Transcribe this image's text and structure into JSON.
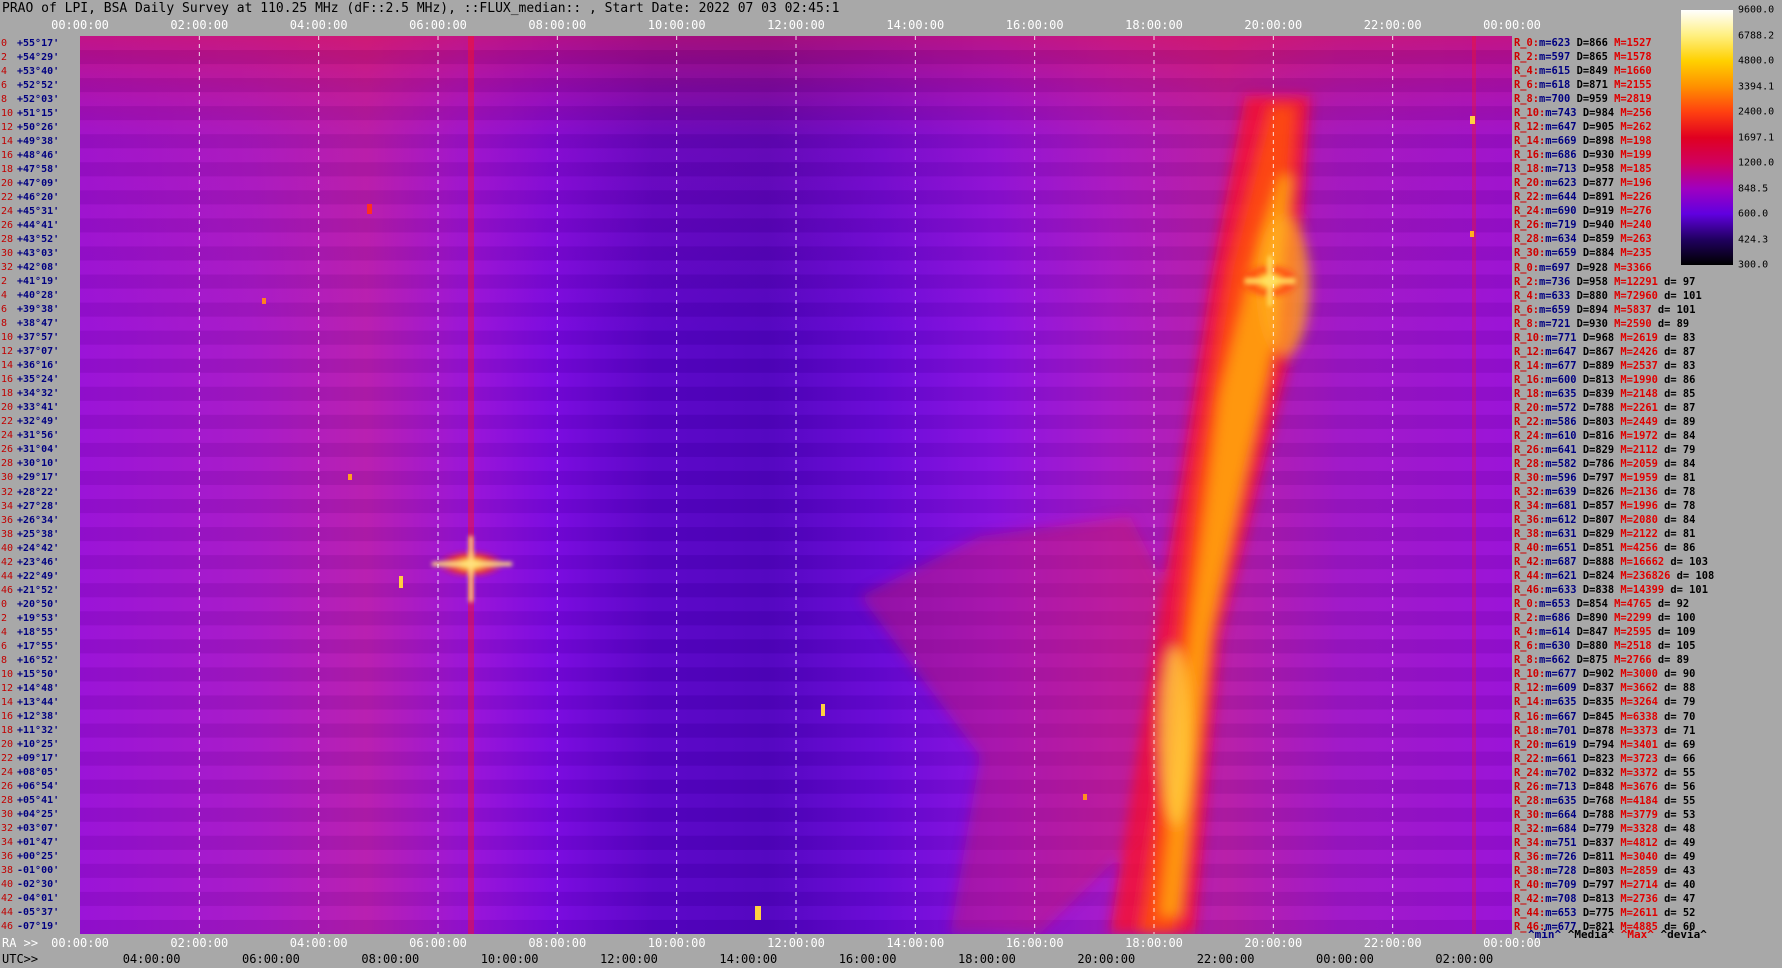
{
  "title": "PRAO of LPI, BSA Daily Survey at 110.25 MHz (dF::2.5 MHz), ::FLUX_median:: , Start Date: 2022 07 03 02:45:1",
  "time_axis": {
    "top_labels": [
      "00:00:00",
      "02:00:00",
      "04:00:00",
      "06:00:00",
      "08:00:00",
      "10:00:00",
      "12:00:00",
      "14:00:00",
      "16:00:00",
      "18:00:00",
      "20:00:00",
      "22:00:00",
      "00:00:00"
    ],
    "ra_prefix": "RA >>",
    "ra_labels": [
      "00:00:00",
      "02:00:00",
      "04:00:00",
      "06:00:00",
      "08:00:00",
      "10:00:00",
      "12:00:00",
      "14:00:00",
      "16:00:00",
      "18:00:00",
      "20:00:00",
      "22:00:00",
      "00:00:00"
    ],
    "utc_prefix": "UTC>>",
    "utc_labels": [
      "04:00:00",
      "06:00:00",
      "08:00:00",
      "10:00:00",
      "12:00:00",
      "14:00:00",
      "16:00:00",
      "18:00:00",
      "20:00:00",
      "22:00:00",
      "00:00:00",
      "02:00:00"
    ]
  },
  "declinations": [
    {
      "i": "0",
      "d": "+55°17'"
    },
    {
      "i": "2",
      "d": "+54°29'"
    },
    {
      "i": "4",
      "d": "+53°40'"
    },
    {
      "i": "6",
      "d": "+52°52'"
    },
    {
      "i": "8",
      "d": "+52°03'"
    },
    {
      "i": "10",
      "d": "+51°15'"
    },
    {
      "i": "12",
      "d": "+50°26'"
    },
    {
      "i": "14",
      "d": "+49°38'"
    },
    {
      "i": "16",
      "d": "+48°46'"
    },
    {
      "i": "18",
      "d": "+47°58'"
    },
    {
      "i": "20",
      "d": "+47°09'"
    },
    {
      "i": "22",
      "d": "+46°20'"
    },
    {
      "i": "24",
      "d": "+45°31'"
    },
    {
      "i": "26",
      "d": "+44°41'"
    },
    {
      "i": "28",
      "d": "+43°52'"
    },
    {
      "i": "30",
      "d": "+43°03'"
    },
    {
      "i": "32",
      "d": "+42°08'"
    },
    {
      "i": "2",
      "d": "+41°19'"
    },
    {
      "i": "4",
      "d": "+40°28'"
    },
    {
      "i": "6",
      "d": "+39°38'"
    },
    {
      "i": "8",
      "d": "+38°47'"
    },
    {
      "i": "10",
      "d": "+37°57'"
    },
    {
      "i": "12",
      "d": "+37°07'"
    },
    {
      "i": "14",
      "d": "+36°16'"
    },
    {
      "i": "16",
      "d": "+35°24'"
    },
    {
      "i": "18",
      "d": "+34°32'"
    },
    {
      "i": "20",
      "d": "+33°41'"
    },
    {
      "i": "22",
      "d": "+32°49'"
    },
    {
      "i": "24",
      "d": "+31°56'"
    },
    {
      "i": "26",
      "d": "+31°04'"
    },
    {
      "i": "28",
      "d": "+30°10'"
    },
    {
      "i": "30",
      "d": "+29°17'"
    },
    {
      "i": "32",
      "d": "+28°22'"
    },
    {
      "i": "34",
      "d": "+27°28'"
    },
    {
      "i": "36",
      "d": "+26°34'"
    },
    {
      "i": "38",
      "d": "+25°38'"
    },
    {
      "i": "40",
      "d": "+24°42'"
    },
    {
      "i": "42",
      "d": "+23°46'"
    },
    {
      "i": "44",
      "d": "+22°49'"
    },
    {
      "i": "46",
      "d": "+21°52'"
    },
    {
      "i": "0",
      "d": "+20°50'"
    },
    {
      "i": "2",
      "d": "+19°53'"
    },
    {
      "i": "4",
      "d": "+18°55'"
    },
    {
      "i": "6",
      "d": "+17°55'"
    },
    {
      "i": "8",
      "d": "+16°52'"
    },
    {
      "i": "10",
      "d": "+15°50'"
    },
    {
      "i": "12",
      "d": "+14°48'"
    },
    {
      "i": "14",
      "d": "+13°44'"
    },
    {
      "i": "16",
      "d": "+12°38'"
    },
    {
      "i": "18",
      "d": "+11°32'"
    },
    {
      "i": "20",
      "d": "+10°25'"
    },
    {
      "i": "22",
      "d": "+09°17'"
    },
    {
      "i": "24",
      "d": "+08°05'"
    },
    {
      "i": "26",
      "d": "+06°54'"
    },
    {
      "i": "28",
      "d": "+05°41'"
    },
    {
      "i": "30",
      "d": "+04°25'"
    },
    {
      "i": "32",
      "d": "+03°07'"
    },
    {
      "i": "34",
      "d": "+01°47'"
    },
    {
      "i": "36",
      "d": "+00°25'"
    },
    {
      "i": "38",
      "d": "-01°00'"
    },
    {
      "i": "40",
      "d": "-02°30'"
    },
    {
      "i": "42",
      "d": "-04°01'"
    },
    {
      "i": "44",
      "d": "-05°37'"
    },
    {
      "i": "46",
      "d": "-07°19'"
    }
  ],
  "stats": [
    {
      "r": "R_0:",
      "m": "623",
      "D": "866",
      "M": "1527",
      "d": ""
    },
    {
      "r": "R_2:",
      "m": "597",
      "D": "865",
      "M": "1578",
      "d": ""
    },
    {
      "r": "R_4:",
      "m": "615",
      "D": "849",
      "M": "1660",
      "d": ""
    },
    {
      "r": "R_6:",
      "m": "618",
      "D": "871",
      "M": "2155",
      "d": ""
    },
    {
      "r": "R_8:",
      "m": "700",
      "D": "959",
      "M": "2819",
      "d": ""
    },
    {
      "r": "R_10:",
      "m": "743",
      "D": "984",
      "M": "256",
      "d": ""
    },
    {
      "r": "R_12:",
      "m": "647",
      "D": "905",
      "M": "262",
      "d": ""
    },
    {
      "r": "R_14:",
      "m": "669",
      "D": "898",
      "M": "198",
      "d": ""
    },
    {
      "r": "R_16:",
      "m": "686",
      "D": "930",
      "M": "199",
      "d": ""
    },
    {
      "r": "R_18:",
      "m": "713",
      "D": "958",
      "M": "185",
      "d": ""
    },
    {
      "r": "R_20:",
      "m": "623",
      "D": "877",
      "M": "196",
      "d": ""
    },
    {
      "r": "R_22:",
      "m": "644",
      "D": "891",
      "M": "226",
      "d": ""
    },
    {
      "r": "R_24:",
      "m": "690",
      "D": "919",
      "M": "276",
      "d": ""
    },
    {
      "r": "R_26:",
      "m": "719",
      "D": "940",
      "M": "240",
      "d": ""
    },
    {
      "r": "R_28:",
      "m": "634",
      "D": "859",
      "M": "263",
      "d": ""
    },
    {
      "r": "R_30:",
      "m": "659",
      "D": "884",
      "M": "235",
      "d": ""
    },
    {
      "r": "R_0:",
      "m": "697",
      "D": "928",
      "M": "3366",
      "d": ""
    },
    {
      "r": "R_2:",
      "m": "736",
      "D": "958",
      "M": "12291",
      "d": "97"
    },
    {
      "r": "R_4:",
      "m": "633",
      "D": "880",
      "M": "72960",
      "d": "101"
    },
    {
      "r": "R_6:",
      "m": "659",
      "D": "894",
      "M": "5837",
      "d": "101"
    },
    {
      "r": "R_8:",
      "m": "721",
      "D": "930",
      "M": "2590",
      "d": "89"
    },
    {
      "r": "R_10:",
      "m": "771",
      "D": "968",
      "M": "2619",
      "d": "83"
    },
    {
      "r": "R_12:",
      "m": "647",
      "D": "867",
      "M": "2426",
      "d": "87"
    },
    {
      "r": "R_14:",
      "m": "677",
      "D": "889",
      "M": "2537",
      "d": "83"
    },
    {
      "r": "R_16:",
      "m": "600",
      "D": "813",
      "M": "1990",
      "d": "86"
    },
    {
      "r": "R_18:",
      "m": "635",
      "D": "839",
      "M": "2148",
      "d": "85"
    },
    {
      "r": "R_20:",
      "m": "572",
      "D": "788",
      "M": "2261",
      "d": "87"
    },
    {
      "r": "R_22:",
      "m": "586",
      "D": "803",
      "M": "2449",
      "d": "89"
    },
    {
      "r": "R_24:",
      "m": "610",
      "D": "816",
      "M": "1972",
      "d": "84"
    },
    {
      "r": "R_26:",
      "m": "641",
      "D": "829",
      "M": "2112",
      "d": "79"
    },
    {
      "r": "R_28:",
      "m": "582",
      "D": "786",
      "M": "2059",
      "d": "84"
    },
    {
      "r": "R_30:",
      "m": "596",
      "D": "797",
      "M": "1959",
      "d": "81"
    },
    {
      "r": "R_32:",
      "m": "639",
      "D": "826",
      "M": "2136",
      "d": "78"
    },
    {
      "r": "R_34:",
      "m": "681",
      "D": "857",
      "M": "1996",
      "d": "78"
    },
    {
      "r": "R_36:",
      "m": "612",
      "D": "807",
      "M": "2080",
      "d": "84"
    },
    {
      "r": "R_38:",
      "m": "631",
      "D": "829",
      "M": "2122",
      "d": "81"
    },
    {
      "r": "R_40:",
      "m": "651",
      "D": "851",
      "M": "4256",
      "d": "86"
    },
    {
      "r": "R_42:",
      "m": "687",
      "D": "888",
      "M": "16662",
      "d": "103"
    },
    {
      "r": "R_44:",
      "m": "621",
      "D": "824",
      "M": "236826",
      "d": "108"
    },
    {
      "r": "R_46:",
      "m": "633",
      "D": "838",
      "M": "14399",
      "d": "101"
    },
    {
      "r": "R_0:",
      "m": "653",
      "D": "854",
      "M": "4765",
      "d": "92"
    },
    {
      "r": "R_2:",
      "m": "686",
      "D": "890",
      "M": "2299",
      "d": "100"
    },
    {
      "r": "R_4:",
      "m": "614",
      "D": "847",
      "M": "2595",
      "d": "109"
    },
    {
      "r": "R_6:",
      "m": "630",
      "D": "880",
      "M": "2518",
      "d": "105"
    },
    {
      "r": "R_8:",
      "m": "662",
      "D": "875",
      "M": "2766",
      "d": "89"
    },
    {
      "r": "R_10:",
      "m": "677",
      "D": "902",
      "M": "3000",
      "d": "90"
    },
    {
      "r": "R_12:",
      "m": "609",
      "D": "837",
      "M": "3662",
      "d": "88"
    },
    {
      "r": "R_14:",
      "m": "635",
      "D": "835",
      "M": "3264",
      "d": "79"
    },
    {
      "r": "R_16:",
      "m": "667",
      "D": "845",
      "M": "6338",
      "d": "70"
    },
    {
      "r": "R_18:",
      "m": "701",
      "D": "878",
      "M": "3373",
      "d": "71"
    },
    {
      "r": "R_20:",
      "m": "619",
      "D": "794",
      "M": "3401",
      "d": "69"
    },
    {
      "r": "R_22:",
      "m": "661",
      "D": "823",
      "M": "3723",
      "d": "66"
    },
    {
      "r": "R_24:",
      "m": "702",
      "D": "832",
      "M": "3372",
      "d": "55"
    },
    {
      "r": "R_26:",
      "m": "713",
      "D": "848",
      "M": "3676",
      "d": "56"
    },
    {
      "r": "R_28:",
      "m": "635",
      "D": "768",
      "M": "4184",
      "d": "55"
    },
    {
      "r": "R_30:",
      "m": "664",
      "D": "788",
      "M": "3779",
      "d": "53"
    },
    {
      "r": "R_32:",
      "m": "684",
      "D": "779",
      "M": "3328",
      "d": "48"
    },
    {
      "r": "R_34:",
      "m": "751",
      "D": "837",
      "M": "4812",
      "d": "49"
    },
    {
      "r": "R_36:",
      "m": "726",
      "D": "811",
      "M": "3040",
      "d": "49"
    },
    {
      "r": "R_38:",
      "m": "728",
      "D": "803",
      "M": "2859",
      "d": "43"
    },
    {
      "r": "R_40:",
      "m": "709",
      "D": "797",
      "M": "2714",
      "d": "40"
    },
    {
      "r": "R_42:",
      "m": "708",
      "D": "813",
      "M": "2736",
      "d": "47"
    },
    {
      "r": "R_44:",
      "m": "653",
      "D": "775",
      "M": "2611",
      "d": "52"
    },
    {
      "r": "R_46:",
      "m": "677",
      "D": "821",
      "M": "4885",
      "d": "60"
    }
  ],
  "legend_footer": {
    "min": "^min^",
    "median": "^Media^",
    "max": "^Max^",
    "devia": "^devia^"
  },
  "colorbar": {
    "labels": [
      "9600.0",
      "6788.2",
      "4800.0",
      "3394.1",
      "2400.0",
      "1697.1",
      "1200.0",
      "848.5",
      "600.0",
      "424.3",
      "300.0"
    ],
    "stops": [
      "#ffffff",
      "#fff080",
      "#ffd000",
      "#ff9000",
      "#ff4010",
      "#e00020",
      "#d00060",
      "#a000c0",
      "#6000e0",
      "#200060",
      "#000000"
    ]
  },
  "chart_data": {
    "type": "heatmap",
    "title": "PRAO of LPI, BSA Daily Survey at 110.25 MHz (dF::2.5 MHz), ::FLUX_median:: , Start Date: 2022 07 03 02:45:1",
    "x_axis": "RA / UTC",
    "y_axis": "Declination",
    "value_range": [
      300.0,
      9600.0
    ],
    "scale": "log",
    "grid": true,
    "features": [
      {
        "name": "bright point source",
        "ra": "06:50",
        "dec": "+23°46'"
      },
      {
        "name": "bright point source",
        "ra": "19:50",
        "dec": "+40°28'"
      },
      {
        "name": "galactic plane band",
        "ra_range": [
          "17:30",
          "21:00"
        ],
        "dec_range": [
          "-07°19'",
          "+52°03'"
        ]
      }
    ]
  }
}
